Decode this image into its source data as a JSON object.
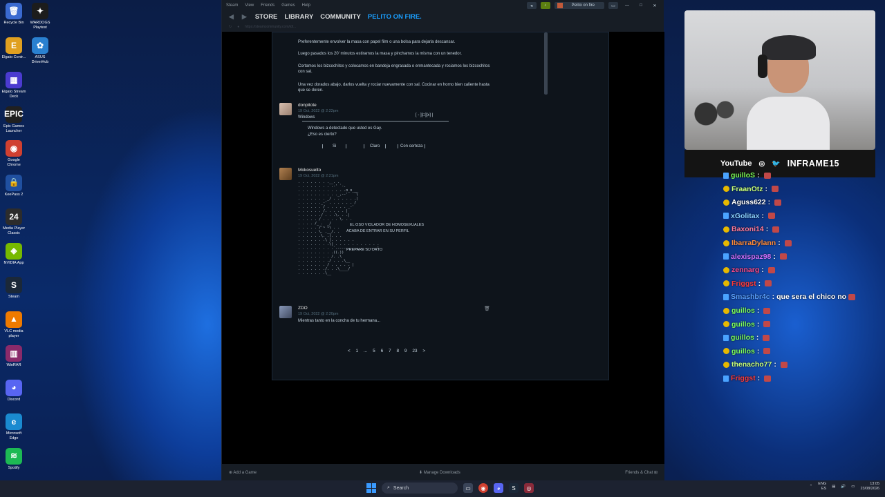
{
  "desktop": {
    "icons": [
      {
        "label": "Recycle Bin",
        "glyph": "🗑",
        "color": "#3a6ad0"
      },
      {
        "label": "WARDOGS Playtest",
        "glyph": "✦",
        "color": "#1c1c1c"
      },
      {
        "label": "Elgato Contr...",
        "glyph": "E",
        "color": "#e0a020"
      },
      {
        "label": "ASUS DriverHub",
        "glyph": "✿",
        "color": "#2a80d0"
      },
      {
        "label": "Elgato Stream Deck",
        "glyph": "▦",
        "color": "#4b3bd0"
      },
      {
        "label": "Epic Games Launcher",
        "glyph": "EPIC",
        "color": "#202020"
      },
      {
        "label": "Google Chrome",
        "glyph": "◉",
        "color": "#d04030"
      },
      {
        "label": "KeePass 2",
        "glyph": "🔒",
        "color": "#2050a0"
      },
      {
        "label": "Media Player Classic",
        "glyph": "24",
        "color": "#2c2c2c"
      },
      {
        "label": "NVIDIA App",
        "glyph": "◈",
        "color": "#76b900"
      },
      {
        "label": "Steam",
        "glyph": "S",
        "color": "#1b2838"
      },
      {
        "label": "VLC media player",
        "glyph": "▲",
        "color": "#ee7a00"
      },
      {
        "label": "WinRAR",
        "glyph": "▥",
        "color": "#8a2a6a"
      },
      {
        "label": "Discord",
        "glyph": "◕",
        "color": "#5865f2"
      },
      {
        "label": "Microsoft Edge",
        "glyph": "e",
        "color": "#1a8ad0"
      },
      {
        "label": "Spotify",
        "glyph": "≋",
        "color": "#1db954"
      }
    ]
  },
  "steam": {
    "menu": [
      "Steam",
      "View",
      "Friends",
      "Games",
      "Help"
    ],
    "profile_chip": "Pelito on fire",
    "nav": {
      "store": "STORE",
      "library": "LIBRARY",
      "community": "COMMUNITY",
      "profile": "PELITO ON FIRE."
    },
    "url": "https://steamcommunity.com/id/...",
    "top_paragraphs": [
      "Preferentemente envolver la masa con papel film o una bolsa para dejarla descansar.",
      "Luego pasados los 20' minutos estiramos la masa y pinchamos la misma con un tenedor.",
      "Cortamos los bizcochitos y colocamos en bandeja engrasada o enmantecada y rociamos los bizcochitos con sal.",
      "Una vez dorados abajo, darlos vuelta y rociar nuevamente con sal. Cocinar en horno bien caliente hasta que se doren."
    ],
    "comments": [
      {
        "author": "donpitote",
        "date": "19 Oct, 2022 @ 2:22pm",
        "lines": {
          "title": "Windows",
          "controls": "[ - ][□][x] |",
          "msg1": "Windows a detectado que usted es Gay.",
          "msg2": "¿Eso es cierto?",
          "btn_si": "Si",
          "btn_claro": "Claro",
          "btn_certeza": "Con certeza"
        }
      },
      {
        "author": "Mokosuelto",
        "date": "19 Oct, 2022 @ 2:21pm",
        "art": {
          "l1": "EL OSO VIOLADOR DE HOMOSEXUALES",
          "l2": "ACABA DE ENTRAR EN SU PERFIL",
          "l3": "PREPARE SU ORTO"
        }
      },
      {
        "author": "ZDO",
        "date": "19 Oct, 2022 @ 2:20pm",
        "text": "Mientras tanto en la concha de tu hermana..."
      }
    ],
    "pager": {
      "prev": "<",
      "next": ">",
      "p1": "1",
      "dots": "...",
      "p5": "5",
      "p6": "6",
      "p7": "7",
      "p8": "8",
      "p9": "9",
      "last": "23"
    },
    "bottom": {
      "add_game": "Add a Game",
      "manage_downloads": "Manage Downloads",
      "friends_chat": "Friends & Chat"
    }
  },
  "stream": {
    "socials_youtube": "YouTube",
    "channel": "INFRAME15"
  },
  "chat": [
    {
      "user": "guilloS",
      "color": "#7cff5a",
      "msg": ""
    },
    {
      "user": "FraanOtz",
      "color": "#c8ff7a",
      "msg": ""
    },
    {
      "user": "Aguss622",
      "color": "#ffffff",
      "msg": ""
    },
    {
      "user": "xGolitax",
      "color": "#8ad0ff",
      "msg": ""
    },
    {
      "user": "Baxoni14",
      "color": "#ff7a9a",
      "msg": ""
    },
    {
      "user": "IbarraDylann",
      "color": "#ff8a3a",
      "msg": ""
    },
    {
      "user": "alexispaz98",
      "color": "#d070ff",
      "msg": ""
    },
    {
      "user": "zennarg",
      "color": "#ff4a8a",
      "msg": ""
    },
    {
      "user": "Friggst",
      "color": "#ff3a3a",
      "msg": ""
    },
    {
      "user": "Smashbr4c",
      "color": "#5aa0ff",
      "msg": "que sera el chico no"
    },
    {
      "user": "guillos",
      "color": "#7cff5a",
      "msg": ""
    },
    {
      "user": "guillos",
      "color": "#7cff5a",
      "msg": ""
    },
    {
      "user": "guillos",
      "color": "#7cff5a",
      "msg": ""
    },
    {
      "user": "guillos",
      "color": "#7cff5a",
      "msg": ""
    },
    {
      "user": "thenacho77",
      "color": "#c8ff7a",
      "msg": ""
    },
    {
      "user": "Friggst",
      "color": "#ff3a3a",
      "msg": ""
    }
  ],
  "taskbar": {
    "search": "Search",
    "lang1": "ENG",
    "lang2": "ES",
    "time": "13:05",
    "date": "23/08/2026"
  }
}
